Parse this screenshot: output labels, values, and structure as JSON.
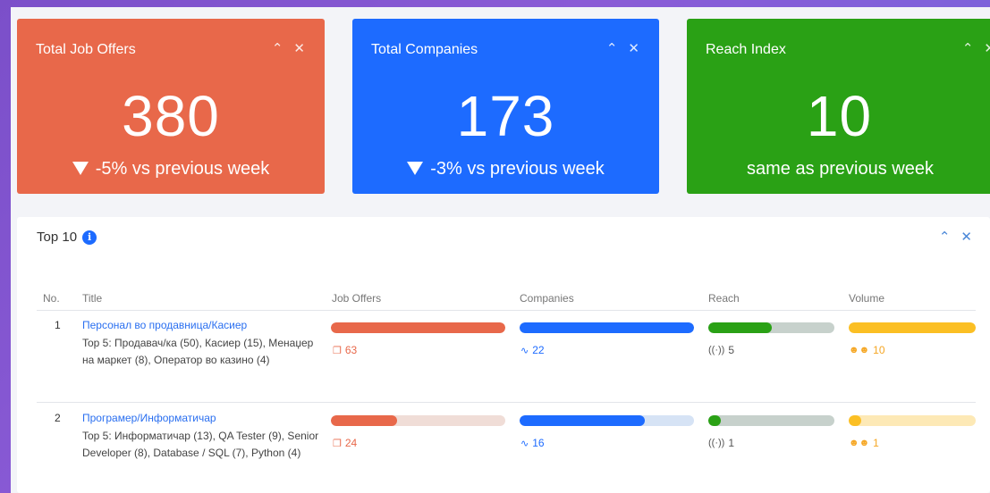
{
  "kpis": [
    {
      "title": "Total Job Offers",
      "value": "380",
      "change": "-5% vs previous week",
      "color": "#e8684a",
      "down": true
    },
    {
      "title": "Total Companies",
      "value": "173",
      "change": "-3% vs previous week",
      "color": "#1d6bff",
      "down": true
    },
    {
      "title": "Reach Index",
      "value": "10",
      "change": "same as previous week",
      "color": "#2aa115",
      "down": false
    }
  ],
  "panel": {
    "title": "Top 10",
    "columns": {
      "no": "No.",
      "title": "Title",
      "job_offers": "Job Offers",
      "companies": "Companies",
      "reach": "Reach",
      "volume": "Volume"
    },
    "rows": [
      {
        "no": "1",
        "title": "Персонал во продавница/Касиер",
        "desc": "Top 5: Продавач/ка (50), Касиер (15), Менаџер на маркет (8), Оператор во казино (4)",
        "job_offers": "63",
        "job_offers_pct": 100,
        "companies": "22",
        "companies_pct": 100,
        "reach": "5",
        "reach_pct": 50,
        "volume": "10",
        "volume_pct": 100
      },
      {
        "no": "2",
        "title": "Програмер/Информатичар",
        "desc": "Top 5: Информатичар (13), QA Tester (9), Senior Developer (8), Database / SQL (7), Python (4)",
        "job_offers": "24",
        "job_offers_pct": 38,
        "companies": "16",
        "companies_pct": 72,
        "reach": "1",
        "reach_pct": 10,
        "volume": "1",
        "volume_pct": 10
      }
    ]
  },
  "icons": {
    "collapse": "chevron-up-icon",
    "close": "close-icon",
    "info": "info-icon",
    "offers": "copy-icon",
    "companies": "pulse-icon",
    "reach": "broadcast-icon",
    "volume": "users-icon"
  }
}
